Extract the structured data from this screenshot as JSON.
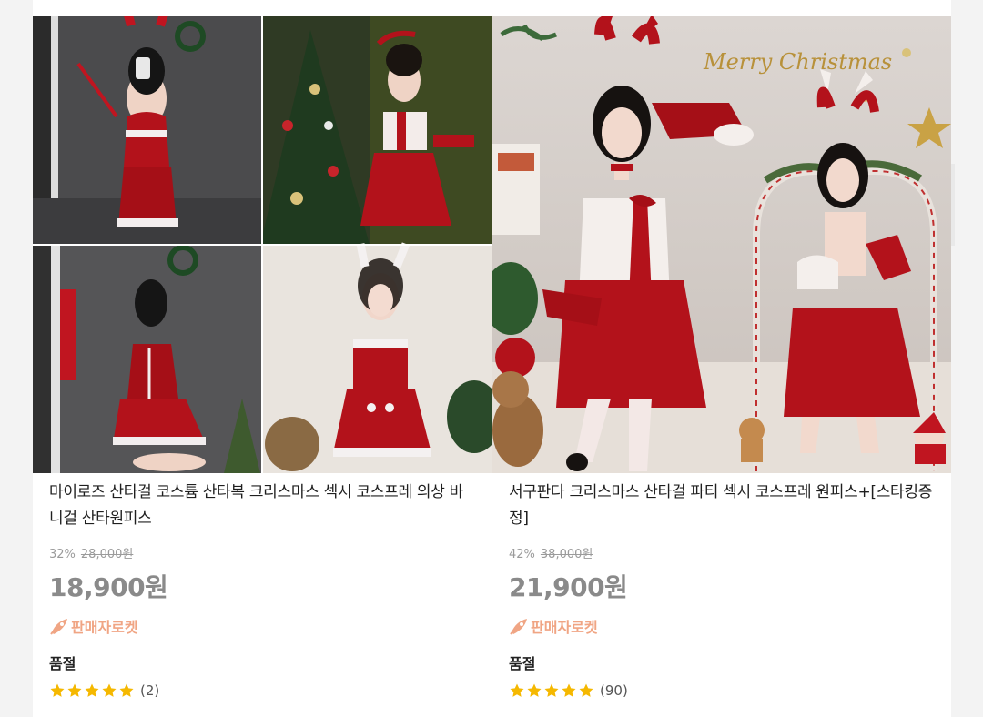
{
  "products": [
    {
      "image_alt": "santa costume photo collage",
      "title": "마이로즈 산타걸 코스튬 산타복 크리스마스 섹시 코스프레 의상 바니걸 산타원피스",
      "discount_percent": "32%",
      "original_price": "28,000원",
      "price": "18,900원",
      "delivery_badge": "판매자로켓",
      "stock_status": "품절",
      "rating": 5,
      "review_count": "(2)"
    },
    {
      "image_alt": "santa bunny costume photo with Merry Christmas lettering",
      "image_text": "Merry Christmas",
      "title": "서구판다 크리스마스 산타걸 파티 섹시 코스프레 원피스+[스타킹증정]",
      "discount_percent": "42%",
      "original_price": "38,000원",
      "price": "21,900원",
      "delivery_badge": "판매자로켓",
      "stock_status": "품절",
      "rating": 5,
      "review_count": "(90)"
    }
  ],
  "colors": {
    "star": "#f5b800",
    "rocket_badge": "#f0a584",
    "price_soldout": "#8a8a8a",
    "costume_red": "#b3121b"
  },
  "icons": [
    "rocket-icon",
    "star-icon"
  ]
}
